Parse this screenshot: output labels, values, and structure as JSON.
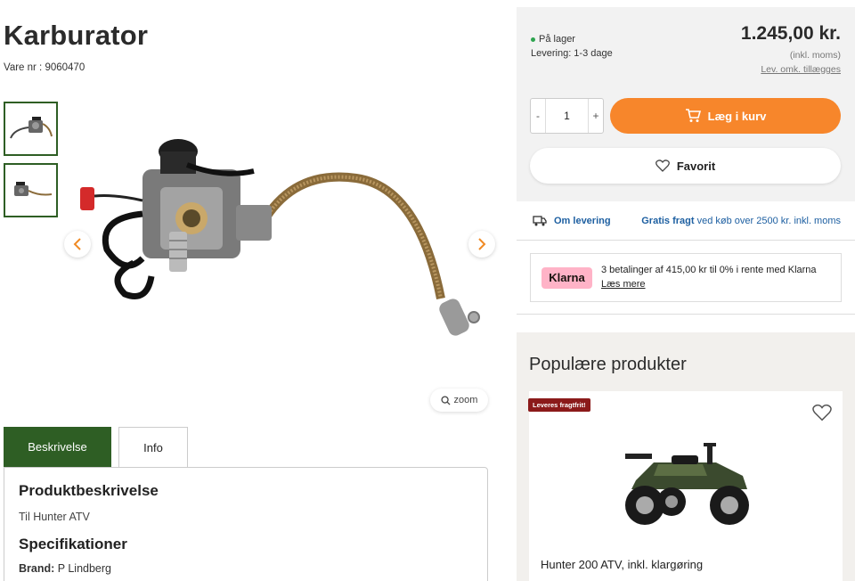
{
  "product": {
    "title": "Karburator",
    "sku": "Vare nr : 9060470"
  },
  "gallery": {
    "zoom_label": "zoom"
  },
  "tabs": [
    {
      "label": "Beskrivelse",
      "active": true
    },
    {
      "label": "Info",
      "active": false
    }
  ],
  "description": {
    "heading": "Produktbeskrivelse",
    "text": "Til Hunter ATV",
    "spec_heading": "Specifikationer",
    "brand_label": "Brand:",
    "brand_value": "P Lindberg"
  },
  "buy": {
    "stock": "På lager",
    "delivery": "Levering: 1-3 dage",
    "price": "1.245,00 kr.",
    "vat": "(inkl. moms)",
    "shipping_cost": "Lev. omk. tillægges",
    "quantity": "1",
    "minus": "-",
    "plus": "+",
    "cart_label": "Læg i kurv",
    "favorite_label": "Favorit",
    "accent_color": "#f7862b",
    "stock_color": "#2ea44f"
  },
  "shipping": {
    "about": "Om levering",
    "free_bold": "Gratis fragt",
    "free_rest": " ved køb over 2500 kr. inkl. moms"
  },
  "klarna": {
    "logo": "Klarna",
    "text": "3 betalinger af 415,00 kr til 0% i rente med Klarna",
    "read_more": "Læs mere"
  },
  "popular": {
    "title": "Populære produkter",
    "products": [
      {
        "badge": "Leveres fragtfrit!",
        "name": "Hunter 200 ATV, inkl. klargøring"
      }
    ]
  }
}
